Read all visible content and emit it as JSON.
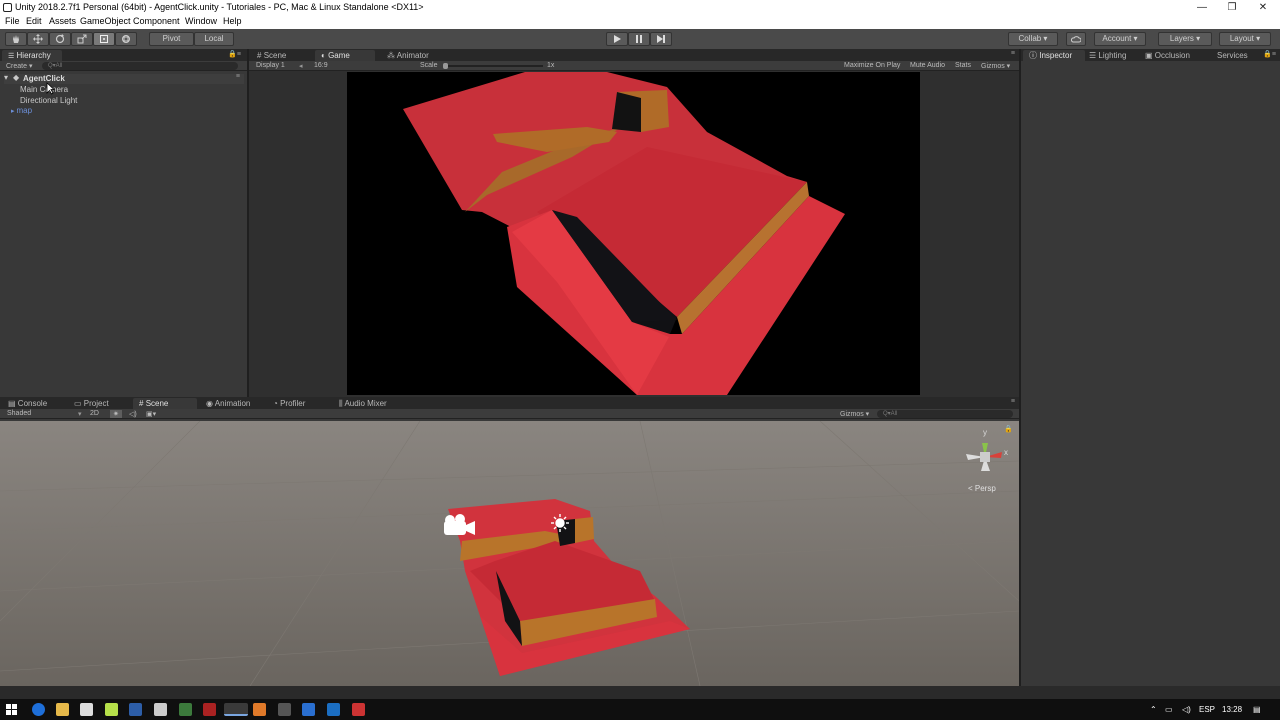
{
  "window": {
    "title": "Unity 2018.2.7f1 Personal (64bit) - AgentClick.unity - Tutoriales - PC, Mac & Linux Standalone <DX11>",
    "minimize": "—",
    "restore": "❐",
    "close": "✕"
  },
  "menu": [
    "File",
    "Edit",
    "Assets",
    "GameObject",
    "Component",
    "Window",
    "Help"
  ],
  "toolbar": {
    "pivot": "Pivot",
    "local": "Local",
    "collab": "Collab ▾",
    "account": "Account ▾",
    "layers": "Layers ▾",
    "layout": "Layout ▾"
  },
  "hierarchy": {
    "tab": "Hierarchy",
    "create": "Create ▾",
    "search_placeholder": "Q▾All",
    "scene_name": "AgentClick",
    "items": [
      "Main Camera",
      "Directional Light",
      "map"
    ]
  },
  "center_tabs": {
    "scene": "Scene",
    "game": "Game",
    "animator": "Animator"
  },
  "game_bar": {
    "display": "Display 1",
    "aspect": "16:9",
    "scale_label": "Scale",
    "scale_value": "1x",
    "maximize": "Maximize On Play",
    "mute": "Mute Audio",
    "stats": "Stats",
    "gizmos": "Gizmos ▾"
  },
  "right_tabs": {
    "inspector": "Inspector",
    "lighting": "Lighting",
    "occlusion": "Occlusion",
    "services": "Services"
  },
  "bottom_tabs": {
    "console": "Console",
    "project": "Project",
    "scene": "Scene",
    "animation": "Animation",
    "profiler": "Profiler",
    "audio_mixer": "Audio Mixer"
  },
  "scene_bar": {
    "shading": "Shaded",
    "mode_2d": "2D",
    "gizmos": "Gizmos ▾",
    "search_placeholder": "Q▾All",
    "persp": "< Persp",
    "axis_y": "y",
    "axis_x": "x"
  },
  "taskbar": {
    "language": "ESP",
    "time": "13:28"
  },
  "colors": {
    "floor_red": "#d1333d",
    "wall_orange": "#b8742a",
    "editor_bg": "#383838",
    "scene_bg": "#6d6863"
  }
}
